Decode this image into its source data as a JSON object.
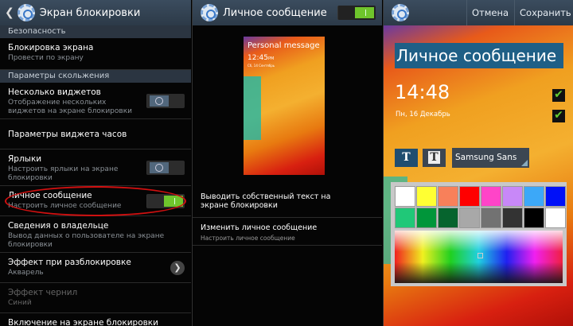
{
  "panel1": {
    "title": "Экран блокировки",
    "sections": [
      {
        "label": "Безопасность"
      },
      {
        "label": "Параметры скольжения"
      }
    ],
    "items": [
      {
        "title": "Блокировка экрана",
        "sub": "Провести по экрану"
      },
      {
        "title": "Несколько виджетов",
        "sub": "Отображение нескольких виджетов на экране блокировки",
        "toggle": "off"
      },
      {
        "title": "Параметры виджета часов"
      },
      {
        "title": "Ярлыки",
        "sub": "Настроить ярлыки на экране блокировки",
        "toggle": "off"
      },
      {
        "title": "Личное сообщение",
        "sub": "Настроить личное сообщение",
        "toggle": "on"
      },
      {
        "title": "Сведения о владельце",
        "sub": "Вывод данных о пользователе на экране блокировки"
      },
      {
        "title": "Эффект при разблокировке",
        "sub": "Акварель"
      },
      {
        "title": "Эффект чернил",
        "sub": "Синий",
        "disabled": true
      },
      {
        "title": "Включение на экране блокировки"
      }
    ]
  },
  "panel2": {
    "title": "Личное сообщение",
    "toggle": "on",
    "preview": {
      "message": "Personal message",
      "time": "12:45",
      "ampm": "PM",
      "date": "Сб, 14 Сентябрь"
    },
    "items": [
      {
        "title": "Выводить собственный текст на экране блокировки"
      },
      {
        "title": "Изменить личное сообщение",
        "sub": "Настроить личное сообщение"
      }
    ]
  },
  "panel3": {
    "cancel": "Отмена",
    "save": "Сохранить",
    "message": "Личное сообщение",
    "clock": "14:48",
    "date": "Пн, 16 Декабрь",
    "check_mark": "✔",
    "text_style_buttons": [
      "T",
      "T"
    ],
    "font": "Samsung Sans",
    "swatches": [
      "#ffffff",
      "#ffff33",
      "#f8805a",
      "#ff0000",
      "#ff44c8",
      "#c888f8",
      "#3ca8f8",
      "#0010f8",
      "#20c878",
      "#00963a",
      "#06642e",
      "#a8a8a8",
      "#727272",
      "#333333",
      "#000000",
      "#ffffff"
    ]
  }
}
